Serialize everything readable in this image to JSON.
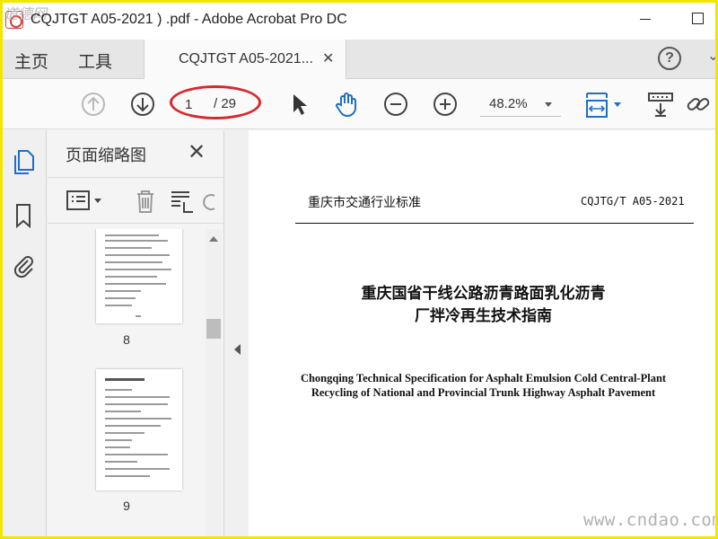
{
  "window": {
    "title": "CQJTGT A05-2021 ) .pdf - Adobe Acrobat Pro DC",
    "logo_text": "道德网"
  },
  "menubar": {
    "home": "主页",
    "tools": "工具",
    "doc_tab": "CQJTGT A05-2021...",
    "doc_tab_close": "✕"
  },
  "toolbar": {
    "page_current": "1",
    "page_total": "/ 29",
    "zoom": "48.2%"
  },
  "panel": {
    "title": "页面缩略图",
    "close": "✕",
    "thumbnails": [
      {
        "page": "8"
      },
      {
        "page": "9"
      }
    ]
  },
  "document": {
    "header_left": "重庆市交通行业标准",
    "header_right": "CQJTG/T  A05-2021",
    "title_cn_line1": "重庆国省干线公路沥青路面乳化沥青",
    "title_cn_line2": "厂拌冷再生技术指南",
    "title_en_line1": "Chongqing Technical Specification for Asphalt Emulsion Cold Central-Plant",
    "title_en_line2": "Recycling of National and Provincial Trunk Highway Asphalt Pavement"
  },
  "watermark": "www.cndao.com",
  "colors": {
    "frame": "#f2e600",
    "annotation": "#d8292a",
    "accent_blue": "#1f6fc4"
  }
}
